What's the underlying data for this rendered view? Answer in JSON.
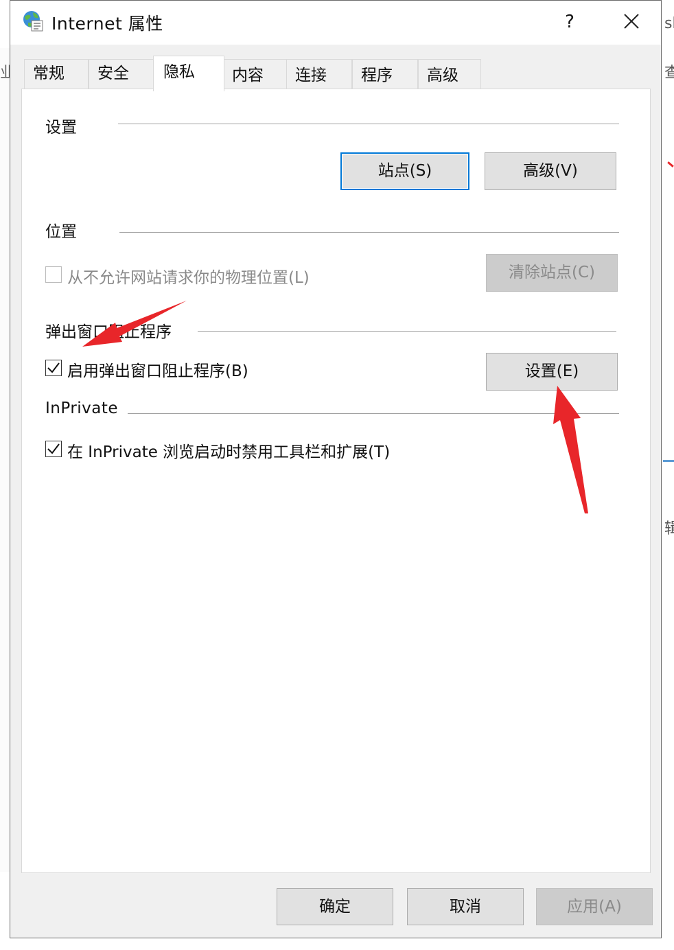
{
  "window": {
    "title": "Internet 属性",
    "help_label": "?"
  },
  "tabs": [
    {
      "label": "常规",
      "active": false
    },
    {
      "label": "安全",
      "active": false
    },
    {
      "label": "隐私",
      "active": true
    },
    {
      "label": "内容",
      "active": false
    },
    {
      "label": "连接",
      "active": false
    },
    {
      "label": "程序",
      "active": false
    },
    {
      "label": "高级",
      "active": false
    }
  ],
  "settings_group": {
    "label": "设置",
    "sites_button": "站点(S)",
    "advanced_button": "高级(V)"
  },
  "location_group": {
    "label": "位置",
    "never_allow_label": "从不允许网站请求你的物理位置(L)",
    "never_allow_checked": false,
    "clear_sites_button": "清除站点(C)"
  },
  "popup_group": {
    "label": "弹出窗口阻止程序",
    "enable_label": "启用弹出窗口阻止程序(B)",
    "enable_checked": true,
    "settings_button": "设置(E)"
  },
  "inprivate_group": {
    "label": "InPrivate",
    "disable_toolbars_label": "在 InPrivate 浏览启动时禁用工具栏和扩展(T)",
    "disable_toolbars_checked": true
  },
  "footer": {
    "ok_button": "确定",
    "cancel_button": "取消",
    "apply_button": "应用(A)"
  },
  "colors": {
    "accent": "#0078d7",
    "annotation_arrow": "#e8262a",
    "dialog_bg": "#f0f0f0",
    "button_bg": "#e1e1e1"
  }
}
